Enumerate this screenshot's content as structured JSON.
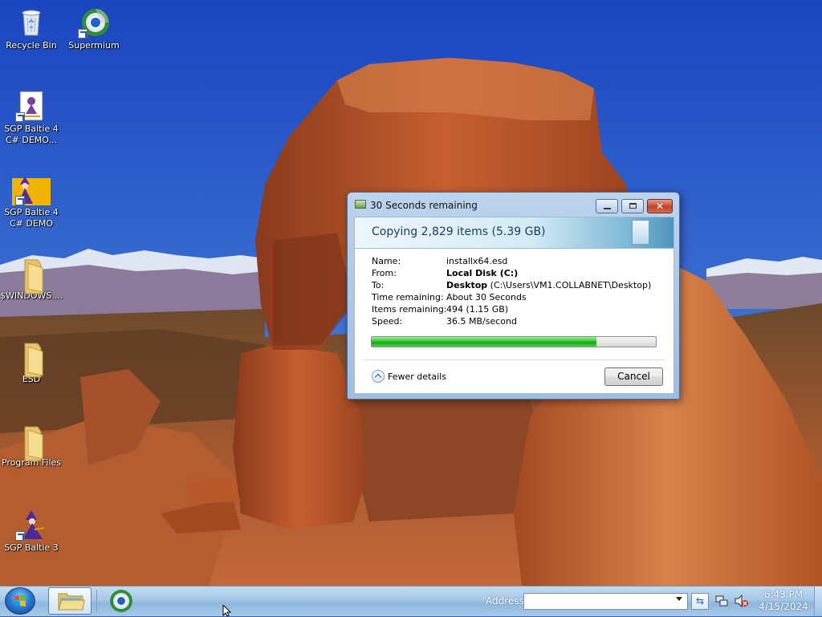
{
  "desktop": {
    "icons": [
      {
        "label": "Recycle Bin",
        "icon": "recycle-bin-icon",
        "shortcut": false
      },
      {
        "label": "Supermium",
        "icon": "supermium-browser-icon",
        "shortcut": true
      },
      {
        "label": "SGP Baltie 4 C# DEMO...",
        "icon": "document-shortcut-icon",
        "shortcut": true
      },
      {
        "label": "SGP Baltie 4 C# DEMO",
        "icon": "wizard-shortcut-icon",
        "shortcut": true
      },
      {
        "label": "$WINDOWS....",
        "icon": "folder-icon",
        "shortcut": false
      },
      {
        "label": "ESD",
        "icon": "folder-icon",
        "shortcut": false
      },
      {
        "label": "Program Files",
        "icon": "folder-icon",
        "shortcut": false
      },
      {
        "label": "SGP Baltie 3",
        "icon": "wizard-shortcut-icon",
        "shortcut": true
      }
    ]
  },
  "dialog": {
    "title": "30 Seconds remaining",
    "heading": "Copying 2,829 items (5.39 GB)",
    "details": [
      {
        "label": "Name:",
        "value_bold": "",
        "value": "installx64.esd"
      },
      {
        "label": "From:",
        "value_bold": "Local Disk (C:)",
        "value": ""
      },
      {
        "label": "To:",
        "value_bold": "Desktop",
        "value": " (C:\\Users\\VM1.COLLABNET\\Desktop)"
      },
      {
        "label": "Time remaining:",
        "value_bold": "",
        "value": "About 30 Seconds"
      },
      {
        "label": "Items remaining:",
        "value_bold": "",
        "value": "494 (1.15 GB)"
      },
      {
        "label": "Speed:",
        "value_bold": "",
        "value": "36.5 MB/second"
      }
    ],
    "progress_fraction": 0.79,
    "fewer_details_label": "Fewer details",
    "cancel_label": "Cancel",
    "colors": {
      "progress": "#23b823",
      "close_button": "#c2432b"
    }
  },
  "taskbar": {
    "address_label": "Address",
    "address_value": "",
    "time": "6:43 PM",
    "date": "4/15/2024"
  }
}
